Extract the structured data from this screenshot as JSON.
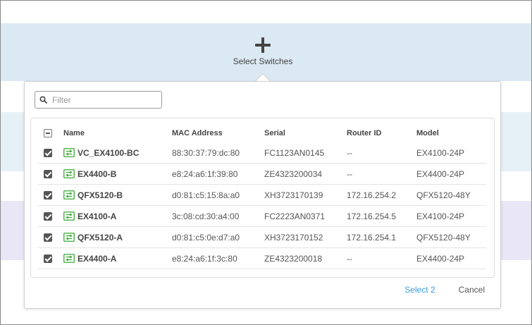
{
  "header": {
    "add_label": "Select Switches",
    "add_icon": "plus-icon"
  },
  "filter": {
    "placeholder": "Filter",
    "value": "",
    "icon": "search-icon"
  },
  "table": {
    "columns": [
      "Name",
      "MAC Address",
      "Serial",
      "Router ID",
      "Model"
    ],
    "rows": [
      {
        "checked": true,
        "name": "VC_EX4100-BC",
        "mac": "88:30:37:79:dc:80",
        "serial": "FC1123AN0145",
        "router_id": "--",
        "model": "EX4100-24P"
      },
      {
        "checked": true,
        "name": "EX4400-B",
        "mac": "e8:24:a6:1f:39:80",
        "serial": "ZE4323200034",
        "router_id": "--",
        "model": "EX4400-24P"
      },
      {
        "checked": true,
        "name": "QFX5120-B",
        "mac": "d0:81:c5:15:8a:a0",
        "serial": "XH3723170139",
        "router_id": "172.16.254.2",
        "model": "QFX5120-48Y"
      },
      {
        "checked": true,
        "name": "EX4100-A",
        "mac": "3c:08:cd:30:a4:00",
        "serial": "FC2223AN0371",
        "router_id": "172.16.254.5",
        "model": "EX4100-24P"
      },
      {
        "checked": true,
        "name": "QFX5120-A",
        "mac": "d0:81:c5:0e:d7:a0",
        "serial": "XH3723170152",
        "router_id": "172.16.254.1",
        "model": "QFX5120-48Y"
      },
      {
        "checked": true,
        "name": "EX4400-A",
        "mac": "e8:24:a6:1f:3c:80",
        "serial": "ZE4323200018",
        "router_id": "--",
        "model": "EX4400-24P"
      }
    ]
  },
  "actions": {
    "select_label": "Select 2",
    "cancel_label": "Cancel"
  },
  "colors": {
    "accent": "#3a9bd6",
    "switch_icon": "#3aa935"
  }
}
